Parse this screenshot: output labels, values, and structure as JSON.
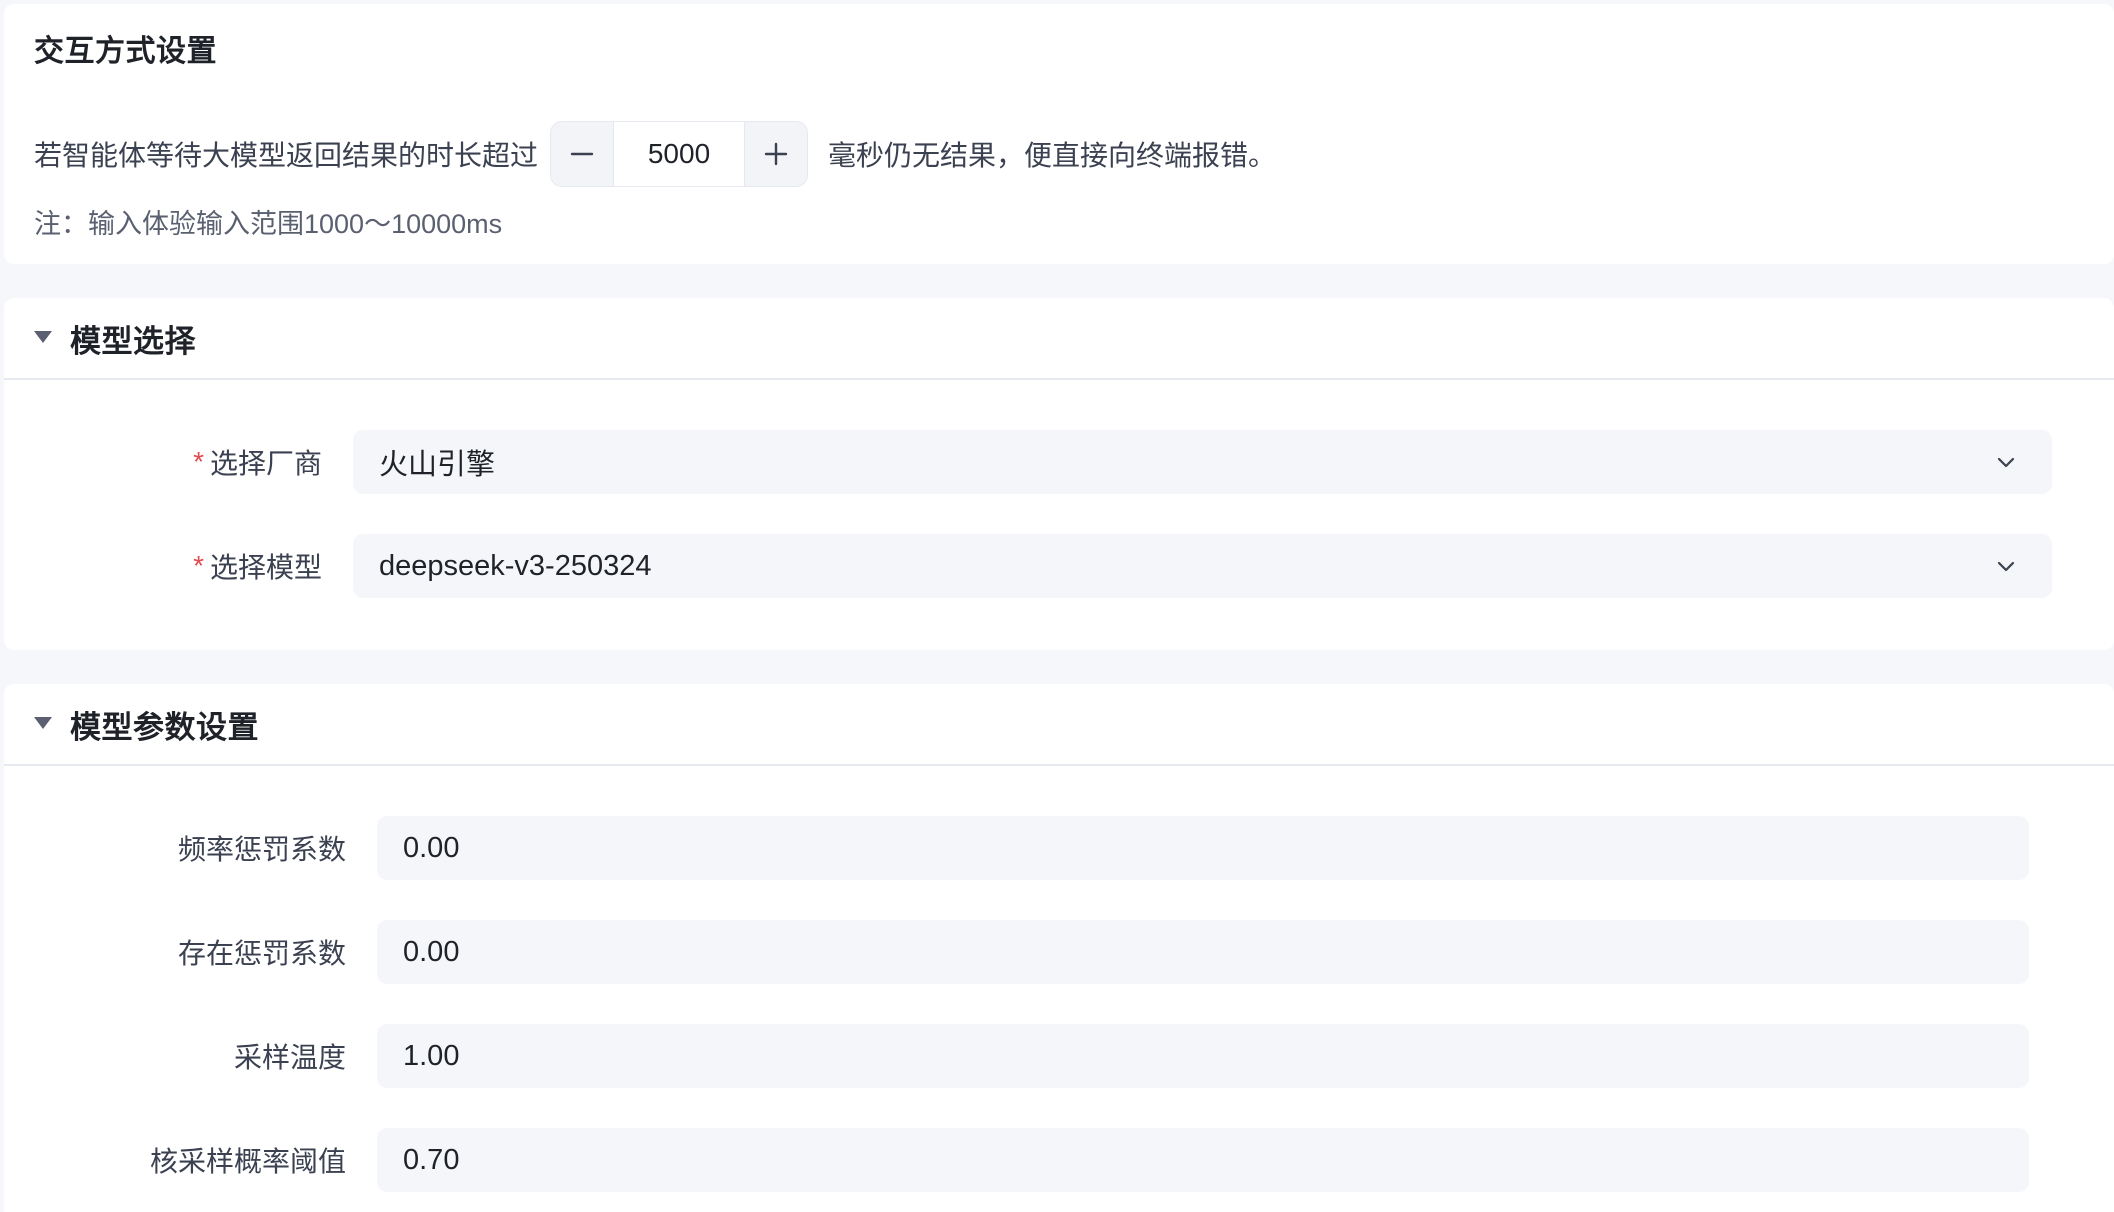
{
  "interaction": {
    "title": "交互方式设置",
    "timeout_prefix": "若智能体等待大模型返回结果的时长超过",
    "timeout_value": "5000",
    "timeout_suffix": "毫秒仍无结果，便直接向终端报错。",
    "note": "注：输入体验输入范围1000～10000ms"
  },
  "model_section": {
    "title": "模型选择",
    "vendor_label": "选择厂商",
    "vendor_value": "火山引擎",
    "model_label": "选择模型",
    "model_value": "deepseek-v3-250324",
    "required_mark": "*"
  },
  "params_section": {
    "title": "模型参数设置",
    "fields": [
      {
        "label": "频率惩罚系数",
        "value": "0.00"
      },
      {
        "label": "存在惩罚系数",
        "value": "0.00"
      },
      {
        "label": "采样温度",
        "value": "1.00"
      },
      {
        "label": "核采样概率阈值",
        "value": "0.70"
      }
    ]
  },
  "icons": {
    "minus": "minus-icon",
    "plus": "plus-icon",
    "caret": "caret-down-icon",
    "chevron": "chevron-down-icon"
  },
  "colors": {
    "required": "#e5484d",
    "field_background": "#f4f6fa",
    "page_background": "#f5f7fb"
  }
}
